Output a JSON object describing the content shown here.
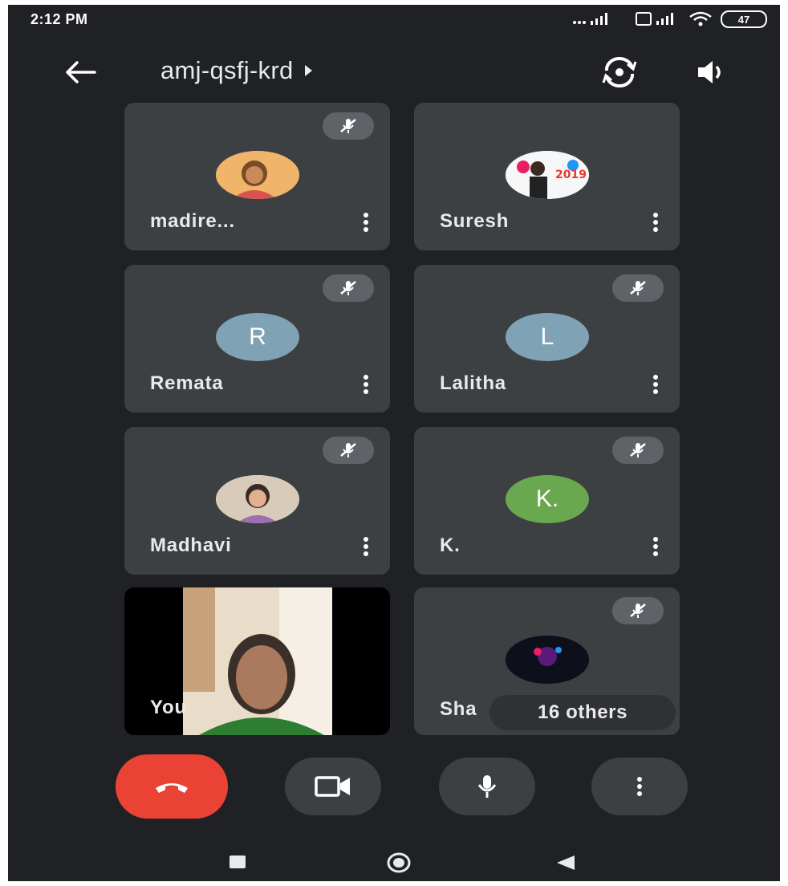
{
  "status": {
    "time": "2:12 PM",
    "battery": "47"
  },
  "header": {
    "meeting_code": "amj-qsfj-krd"
  },
  "tiles": [
    {
      "name": "madire...",
      "avatar_type": "photo",
      "muted": true
    },
    {
      "name": "Suresh",
      "avatar_type": "photo",
      "muted": false
    },
    {
      "name": "Remata",
      "avatar_letter": "R",
      "avatar_color": "#8ab4c8",
      "muted": true
    },
    {
      "name": "Lalitha",
      "avatar_letter": "L",
      "avatar_color": "#8ab4c8",
      "muted": true
    },
    {
      "name": "Madhavi",
      "avatar_type": "photo",
      "muted": true
    },
    {
      "name": "K.",
      "avatar_letter": "K.",
      "avatar_color": "#6aa84f",
      "muted": true
    },
    {
      "name": "You",
      "avatar_type": "video",
      "muted": false
    },
    {
      "name": "Sha",
      "avatar_type": "photo",
      "muted": true
    }
  ],
  "others_label": "16 others",
  "colors": {
    "end_call": "#ea4335",
    "tile_bg": "#3c4043",
    "background": "#202124"
  }
}
